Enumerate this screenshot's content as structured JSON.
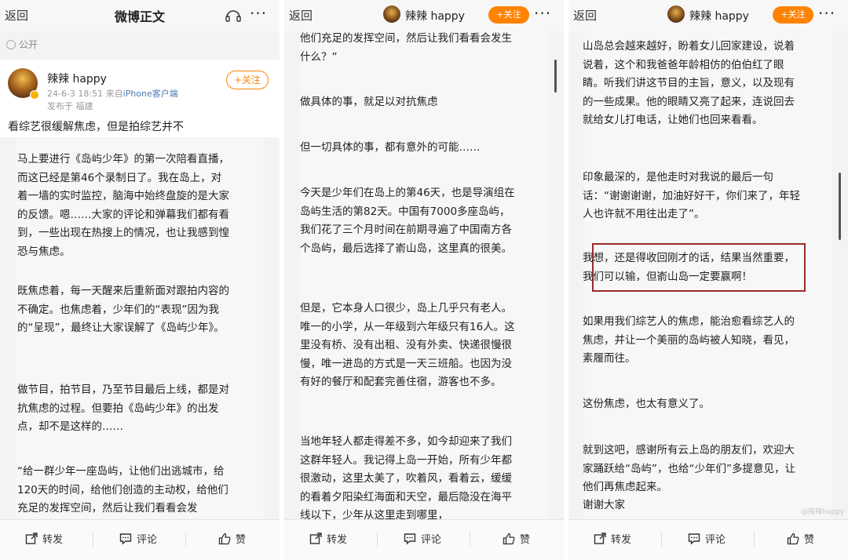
{
  "panels": [
    {
      "topbar": {
        "back": "返回",
        "title": "微博正文"
      },
      "public_label": "公开",
      "author": {
        "name": "辣辣 happy",
        "time": "24-6-3 18:51",
        "from_prefix": "来自",
        "client": "iPhone客户端",
        "location": "发布于 福建"
      },
      "follow_label": "+关注",
      "lead": "看综艺很缓解焦虑，但是拍综艺并不",
      "paragraphs": [
        "马上要进行《岛屿少年》的第一次陪看直播，而这已经是第46个录制日了。我在岛上，对着一墙的实时监控，脑海中始终盘旋的是大家的反馈。嗯……大家的评论和弹幕我们都有看到，一些出现在热搜上的情况，也让我感到惶恐与焦虑。",
        "既焦虑着，每一天醒来后重新面对跟拍内容的不确定。也焦虑着，少年们的“表现”因为我的“呈现”，最终让大家误解了《岛屿少年》。",
        "做节目，拍节目，乃至节目最后上线，都是对抗焦虑的过程。但要拍《岛屿少年》的出发点，却不是这样的……",
        "“给一群少年一座岛屿，让他们出逃城市，给120天的时间，给他们创造的主动权，给他们充足的发挥空间，然后让我们看看会发"
      ]
    },
    {
      "topbar": {
        "back": "返回",
        "name": "辣辣 happy",
        "follow": "+关注"
      },
      "paragraphs": [
        "他们充足的发挥空间，然后让我们看看会发生什么？”",
        "做具体的事，就足以对抗焦虑",
        "但一切具体的事，都有意外的可能……",
        "今天是少年们在岛上的第46天，也是导演组在岛屿生活的第82天。中国有7000多座岛屿，我们花了三个月时间在前期寻遍了中国南方各个岛屿，最后选择了嵛山岛，这里真的很美。",
        "但是，它本身人口很少，岛上几乎只有老人。唯一的小学，从一年级到六年级只有16人。这里没有桥、没有出租、没有外卖、快递很慢很慢，唯一进岛的方式是一天三班船。也因为没有好的餐厅和配套完善住宿，游客也不多。",
        "当地年轻人都走得差不多，如今却迎来了我们这群年轻人。我记得上岛一开始，所有少年都很激动，这里太美了，吹着风，看着云，缓缓的看着夕阳染红海面和天空，最后隐没在海平线以下，少年从这里走到哪里，"
      ]
    },
    {
      "topbar": {
        "back": "返回",
        "name": "辣辣 happy",
        "follow": "+关注"
      },
      "paragraphs": [
        "山岛总会越来越好，盼着女儿回家建设，说着说着，这个和我爸爸年龄相仿的伯伯红了眼睛。听我们讲这节目的主旨，意义，以及现有的一些成果。他的眼睛又亮了起来，连说回去就给女儿打电话，让她们也回来看看。",
        "印象最深的，是他走时对我说的最后一句话：“谢谢谢谢，加油好好干，你们来了，年轻人也许就不用往出走了”。",
        "我想，还是得收回刚才的话，结果当然重要，我们可以输，但嵛山岛一定要赢啊！",
        "如果用我们综艺人的焦虑，能治愈看综艺人的焦虑，并让一个美丽的岛屿被人知晓，看见，素履而往。",
        "这份焦虑，也太有意义了。",
        "就到这吧，感谢所有云上岛的朋友们，欢迎大家踊跃给“岛屿”，也给“少年们”多提意见，让他们再焦虑起来。",
        "谢谢大家"
      ],
      "watermark": "@辣辣happy"
    }
  ],
  "bottom": {
    "repost": "转发",
    "comment": "评论",
    "like": "赞"
  },
  "colors": {
    "accent": "#ff8200",
    "highlight_border": "#9a2a2a",
    "link": "#4a7ab0"
  }
}
